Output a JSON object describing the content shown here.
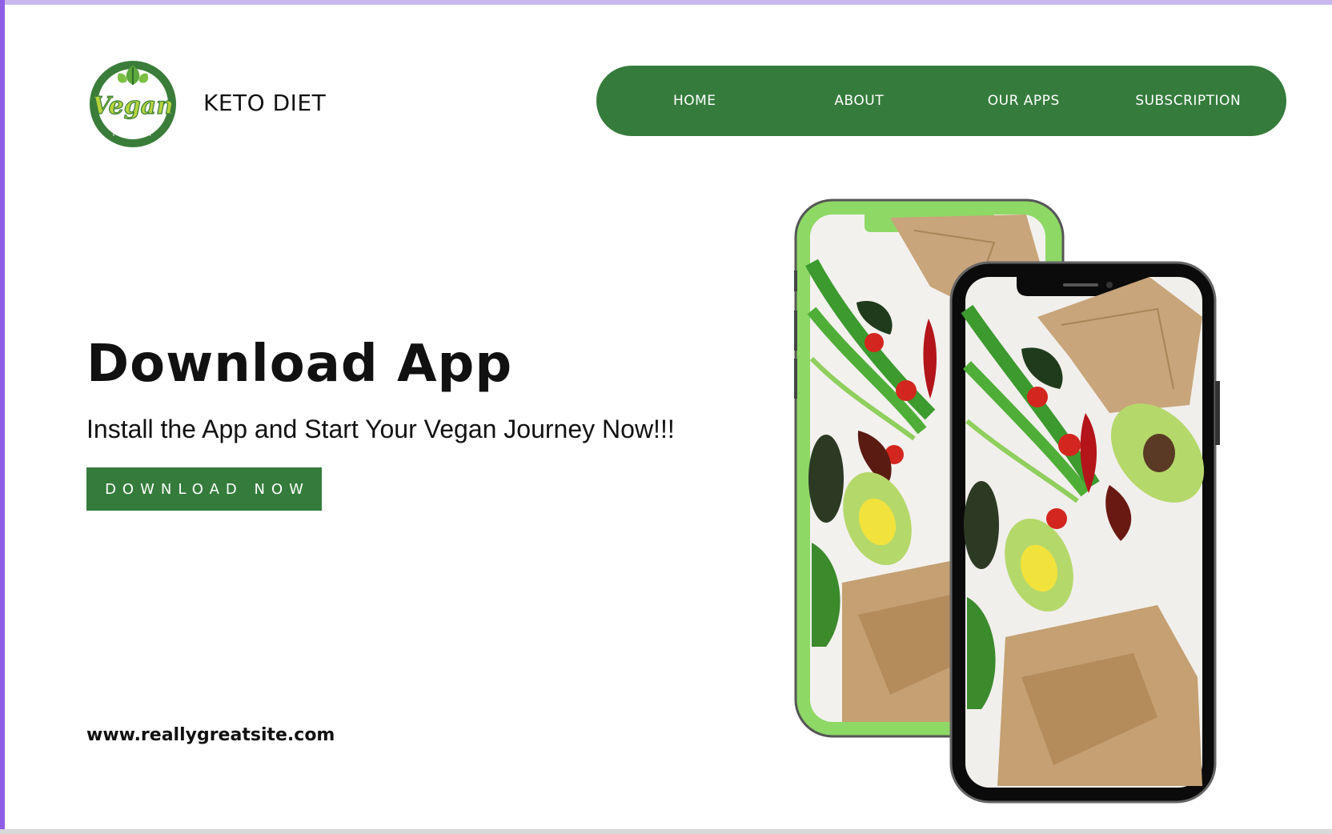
{
  "brand": {
    "name": "KETO DIET",
    "logo_text": "Vegan",
    "logo_subtext": "FRIENDLY"
  },
  "nav": {
    "items": [
      {
        "label": "HOME"
      },
      {
        "label": "ABOUT"
      },
      {
        "label": "OUR APPS"
      },
      {
        "label": "SUBSCRIPTION"
      }
    ]
  },
  "hero": {
    "title": "Download App",
    "subtitle": "Install the App and Start Your Vegan Journey Now!!!",
    "cta_label": "DOWNLOAD NOW"
  },
  "footer": {
    "site_url": "www.reallygreatsite.com"
  },
  "colors": {
    "brand_green": "#357c3c",
    "phone_back_body": "#8ed866",
    "phone_front_body": "#0b0b0b",
    "phone_frame": "#555555"
  },
  "icons": {
    "logo": "vegan-friendly-badge",
    "phone_back": "smartphone-green-mockup",
    "phone_front": "smartphone-black-mockup"
  }
}
